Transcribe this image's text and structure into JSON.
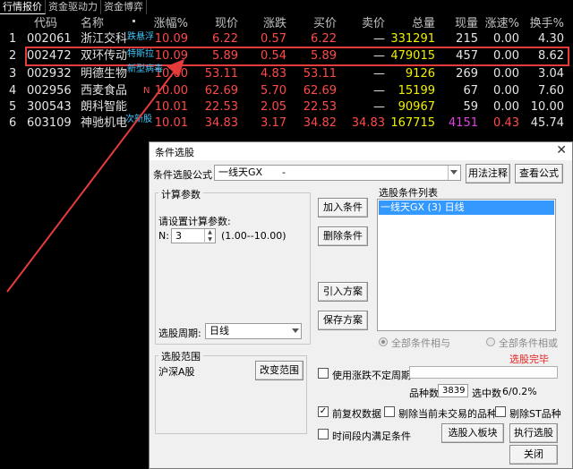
{
  "tabs": [
    "行情报价",
    "资金驱动力",
    "资金博弈"
  ],
  "columns": {
    "code": "代码",
    "name": "名称",
    "chg": "涨幅%",
    "price": "现价",
    "diff": "涨跌",
    "bid": "买价",
    "ask": "卖价",
    "vol": "总量",
    "cur": "现量",
    "spd": "涨速%",
    "turn": "换手%"
  },
  "rows": [
    {
      "idx": "1",
      "code": "002061",
      "name": "浙江交科",
      "tag": "跌悬浮",
      "chg": "10.09",
      "price": "6.22",
      "diff": "0.57",
      "bid": "6.22",
      "ask": "—",
      "vol": "331291",
      "cur": "215",
      "spd": "0.00",
      "turn": "4.30"
    },
    {
      "idx": "2",
      "code": "002472",
      "name": "双环传动",
      "tag": "特斯拉",
      "chg": "10.09",
      "price": "5.89",
      "diff": "0.54",
      "bid": "5.89",
      "ask": "—",
      "vol": "479015",
      "cur": "457",
      "spd": "0.00",
      "turn": "8.62"
    },
    {
      "idx": "3",
      "code": "002932",
      "name": "明德生物",
      "tag": "新型病毒",
      "chg": "10.00",
      "price": "53.11",
      "diff": "4.83",
      "bid": "53.11",
      "ask": "—",
      "vol": "9126",
      "cur": "269",
      "spd": "0.00",
      "turn": "3.04"
    },
    {
      "idx": "4",
      "code": "002956",
      "name": "西麦食品",
      "tag": "N",
      "chg": "10.00",
      "price": "62.69",
      "diff": "5.70",
      "bid": "62.69",
      "ask": "—",
      "vol": "15199",
      "cur": "67",
      "spd": "0.00",
      "turn": "7.60"
    },
    {
      "idx": "5",
      "code": "300543",
      "name": "朗科智能",
      "tag": "",
      "chg": "10.01",
      "price": "22.53",
      "diff": "2.05",
      "bid": "22.53",
      "ask": "—",
      "vol": "90967",
      "cur": "59",
      "spd": "0.00",
      "turn": "10.00"
    },
    {
      "idx": "6",
      "code": "603109",
      "name": "神驰机电",
      "tag": "次新股",
      "chg": "10.01",
      "price": "34.83",
      "diff": "3.17",
      "bid": "34.82",
      "ask": "34.83",
      "vol": "167715",
      "cur": "4151",
      "spd": "0.43",
      "turn": "45.74"
    }
  ],
  "dialog": {
    "title": "条件选股",
    "formula_label": "条件选股公式",
    "formula_value": "一线天GX　　-",
    "usage_button": "用法注释",
    "view_formula_button": "查看公式",
    "params_group": "计算参数",
    "params_prompt": "请设置计算参数:",
    "n_label": "N:",
    "n_value": "3",
    "n_range": "(1.00--10.00)",
    "period_label": "选股周期:",
    "period_value": "日线",
    "add_condition": "加入条件",
    "delete_condition": "删除条件",
    "import_plan": "引入方案",
    "save_plan": "保存方案",
    "condition_list_label": "选股条件列表",
    "condition_item": "一线天GX (3) 日线",
    "radio_and": "全部条件相与",
    "radio_or": "全部条件相或",
    "range_group": "选股范围",
    "range_value": "沪深A股",
    "change_range": "改变范围",
    "status": "选股完毕",
    "variable_period": "使用涨跌不定周期",
    "stock_count_label": "品种数",
    "stock_count": "3839",
    "selected_label": "选中数",
    "selected_value": "6/0.2%",
    "pre_adjust": "前复权数据",
    "exclude_untraded": "剔除当前未交易的品种",
    "exclude_st": "剔除ST品种",
    "in_period": "时间段内满足条件",
    "to_block": "选股入板块",
    "run_select": "执行选股",
    "close": "关闭"
  }
}
